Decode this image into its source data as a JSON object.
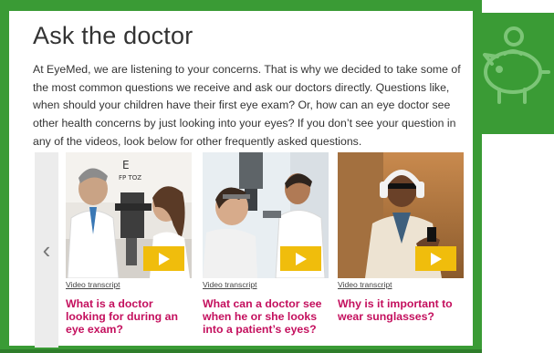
{
  "page": {
    "title": "Ask the doctor",
    "intro": "At EyeMed, we are listening to your concerns. That is why we decided to take some of the most common questions we receive and ask our doctors directly. Questions like, when should your children have their first eye exam? Or, how can an eye doctor see other health concerns by just looking into your eyes? If you don’t see your question in any of the videos, look below for other frequently asked questions."
  },
  "carousel": {
    "prev_glyph": "‹",
    "cards": [
      {
        "transcript_label": "Video transcript",
        "question": "What is a doctor looking for during an eye exam?",
        "image": "doctor-examining-patient-photo"
      },
      {
        "transcript_label": "Video transcript",
        "question": "What can a doctor see when he or she looks into a patient’s eyes?",
        "image": "patient-at-slit-lamp-photo"
      },
      {
        "transcript_label": "Video transcript",
        "question": "Why is it important to wear sunglasses?",
        "image": "man-with-headphones-photo"
      }
    ]
  },
  "colors": {
    "frame_green": "#3a9b35",
    "question_magenta": "#c4105e",
    "play_yellow": "#f0bd0c"
  },
  "icons": [
    "piggy-bank-icon",
    "chevron-left-icon",
    "play-icon"
  ]
}
